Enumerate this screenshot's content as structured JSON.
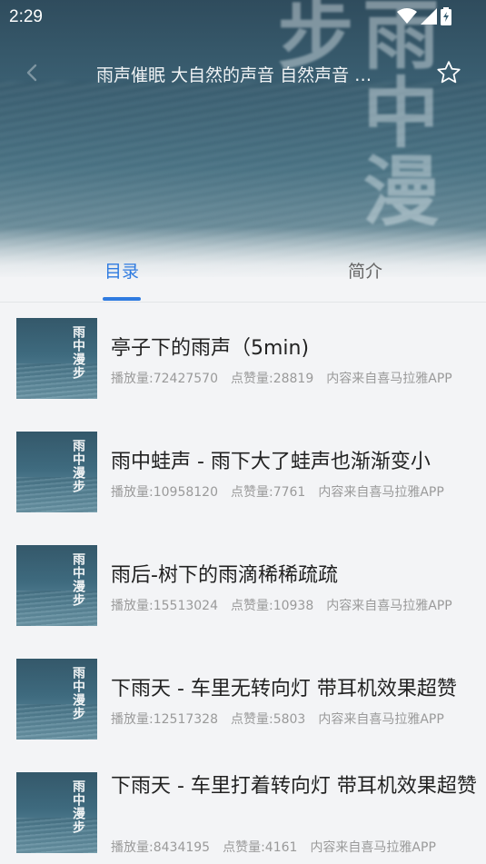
{
  "status_bar": {
    "time": "2:29"
  },
  "header": {
    "title": "雨声催眠 大自然的声音 自然声音 …",
    "cover_text": "雨中漫步"
  },
  "tabs": [
    {
      "label": "目录",
      "active": true
    },
    {
      "label": "简介",
      "active": false
    }
  ],
  "tracks": [
    {
      "title": "亭子下的雨声（5min)",
      "plays": "播放量:72427570",
      "likes": "点赞量:28819",
      "source": "内容来自喜马拉雅APP"
    },
    {
      "title": "雨中蛙声 - 雨下大了蛙声也渐渐变小",
      "plays": "播放量:10958120",
      "likes": "点赞量:7761",
      "source": "内容来自喜马拉雅APP"
    },
    {
      "title": "雨后-树下的雨滴稀稀疏疏",
      "plays": "播放量:15513024",
      "likes": "点赞量:10938",
      "source": "内容来自喜马拉雅APP"
    },
    {
      "title": "下雨天 - 车里无转向灯 带耳机效果超赞",
      "plays": "播放量:12517328",
      "likes": "点赞量:5803",
      "source": "内容来自喜马拉雅APP"
    },
    {
      "title": "下雨天 - 车里打着转向灯 带耳机效果超赞",
      "plays": "播放量:8434195",
      "likes": "点赞量:4161",
      "source": "内容来自喜马拉雅APP"
    }
  ],
  "thumbnail": {
    "text": "雨中漫步"
  },
  "colors": {
    "accent": "#2f7be0",
    "title_text": "#222222",
    "meta_text": "#9a9a9a",
    "background": "#f3f4f6"
  },
  "icons": {
    "back": "arrow-left-icon",
    "favorite": "star-outline-icon",
    "wifi": "wifi-icon",
    "signal": "signal-icon",
    "battery": "battery-icon"
  }
}
